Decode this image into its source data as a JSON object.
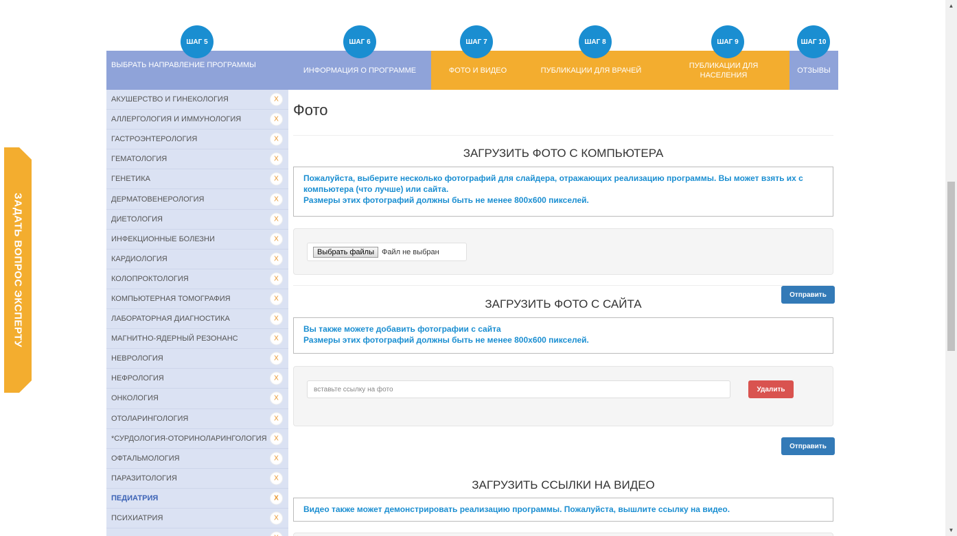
{
  "expert_tab": {
    "label": "ЗАДАТЬ ВОПРОС ЭКСПЕРТУ"
  },
  "steps": [
    {
      "circle": "ШАГ 5",
      "label": "ВЫБРАТЬ НАПРАВЛЕНИЕ ПРОГРАММЫ"
    },
    {
      "circle": "ШАГ 6",
      "label": "ИНФОРМАЦИЯ О ПРОГРАММЕ"
    },
    {
      "circle": "ШАГ 7",
      "label": "ФОТО И ВИДЕО"
    },
    {
      "circle": "ШАГ 8",
      "label": "ПУБЛИКАЦИИ ДЛЯ ВРАЧЕЙ"
    },
    {
      "circle": "ШАГ 9",
      "label": "ПУБЛИКАЦИИ ДЛЯ НАСЕЛЕНИЯ"
    },
    {
      "circle": "ШАГ 10",
      "label": "ОТЗЫВЫ"
    }
  ],
  "sidebar": {
    "remove_glyph": "x",
    "items": [
      "АКУШЕРСТВО И ГИНЕКОЛОГИЯ",
      "АЛЛЕРГОЛОГИЯ И ИММУНОЛОГИЯ",
      "ГАСТРОЭНТЕРОЛОГИЯ",
      "ГЕМАТОЛОГИЯ",
      "ГЕНЕТИКА",
      "ДЕРМАТОВЕНЕРОЛОГИЯ",
      "ДИЕТОЛОГИЯ",
      "ИНФЕКЦИОННЫЕ БОЛЕЗНИ",
      "КАРДИОЛОГИЯ",
      "КОЛОПРОКТОЛОГИЯ",
      "КОМПЬЮТЕРНАЯ ТОМОГРАФИЯ",
      "ЛАБОРАТОРНАЯ ДИАГНОСТИКА",
      "МАГНИТНО-ЯДЕРНЫЙ РЕЗОНАНС",
      "НЕВРОЛОГИЯ",
      "НЕФРОЛОГИЯ",
      "ОНКОЛОГИЯ",
      "ОТОЛАРИНГОЛОГИЯ",
      "*СУРДОЛОГИЯ-ОТОРИНОЛАРИНГОЛОГИЯ",
      "ОФТАЛЬМОЛОГИЯ",
      "ПАРАЗИТОЛОГИЯ",
      "ПЕДИАТРИЯ",
      "ПСИХИАТРИЯ",
      ""
    ],
    "active_item": "ПЕДИАТРИЯ"
  },
  "main": {
    "title": "Фото",
    "upload_computer": {
      "heading": "ЗАГРУЗИТЬ ФОТО С КОМПЬЮТЕРА",
      "info_line1": "Пожалуйста, выберите несколько фотографий для слайдера, отражающих реализацию программы. Вы может взять их с компьютера (что лучше) или сайта.",
      "info_line2": "Размеры этих фотографий должны быть не менее 800х600 пикселей.",
      "choose_files_label": "Выбрать файлы",
      "no_file_label": "Файл не выбран",
      "send_label": "Отправить"
    },
    "upload_site": {
      "heading": "ЗАГРУЗИТЬ ФОТО С САЙТА",
      "info_line1": "Вы также можете добавить фотографии с сайта",
      "info_line2": "Размеры этих фотографий должны быть не менее 800х600 пикселей.",
      "link_placeholder": "вставьте ссылку на фото",
      "delete_label": "Удалить",
      "send_label": "Отправить"
    },
    "upload_video": {
      "heading": "ЗАГРУЗИТЬ ССЫЛКИ НА ВИДЕО",
      "info_line1": "Видео также может демонстрировать реализацию программы. Пожалуйста, вышлите ссылку на видео."
    }
  },
  "scrollbar": {
    "up_glyph": "▲",
    "down_glyph": "▼"
  }
}
